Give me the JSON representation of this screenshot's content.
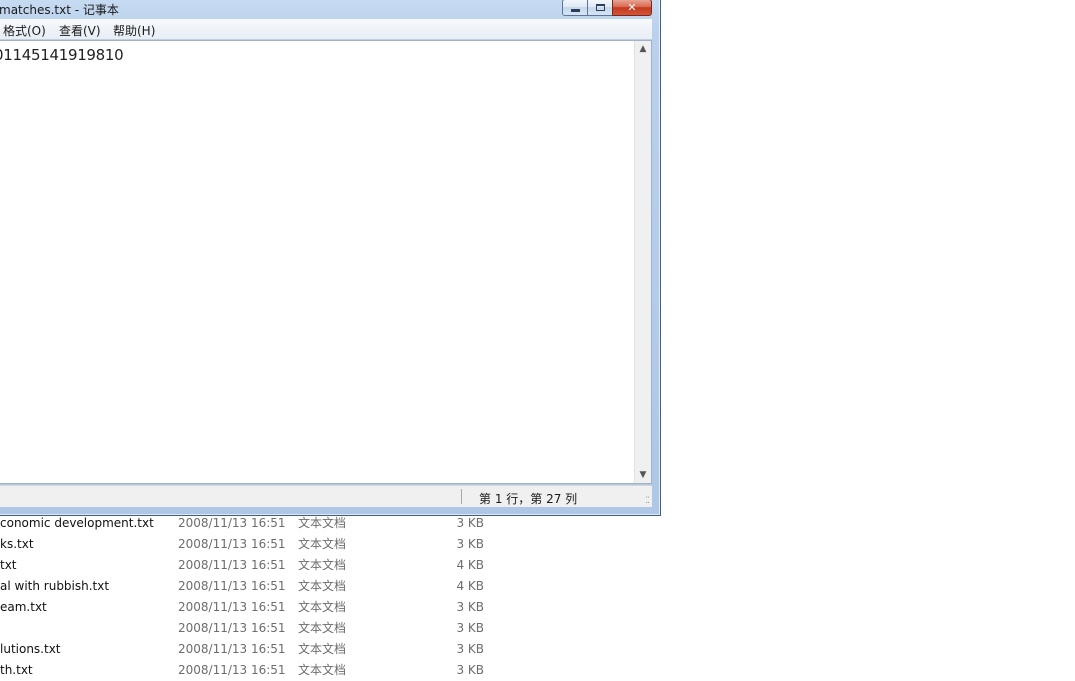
{
  "notepad": {
    "title": "matches.txt - 记事本",
    "menu": [
      "格式(O)",
      "查看(V)",
      "帮助(H)"
    ],
    "content": "01145141919810",
    "status_position": "第 1 行，第 27 列"
  },
  "files": [
    {
      "name": "conomic development.txt",
      "date": "2008/11/13 16:51",
      "type": "文本文档",
      "size": "3 KB"
    },
    {
      "name": "ks.txt",
      "date": "2008/11/13 16:51",
      "type": "文本文档",
      "size": "3 KB"
    },
    {
      "name": "txt",
      "date": "2008/11/13 16:51",
      "type": "文本文档",
      "size": "4 KB"
    },
    {
      "name": "al with rubbish.txt",
      "date": "2008/11/13 16:51",
      "type": "文本文档",
      "size": "4 KB"
    },
    {
      "name": "eam.txt",
      "date": "2008/11/13 16:51",
      "type": "文本文档",
      "size": "3 KB"
    },
    {
      "name": "",
      "date": "2008/11/13 16:51",
      "type": "文本文档",
      "size": "3 KB"
    },
    {
      "name": "lutions.txt",
      "date": "2008/11/13 16:51",
      "type": "文本文档",
      "size": "3 KB"
    },
    {
      "name": "th.txt",
      "date": "2008/11/13 16:51",
      "type": "文本文档",
      "size": "3 KB"
    }
  ]
}
